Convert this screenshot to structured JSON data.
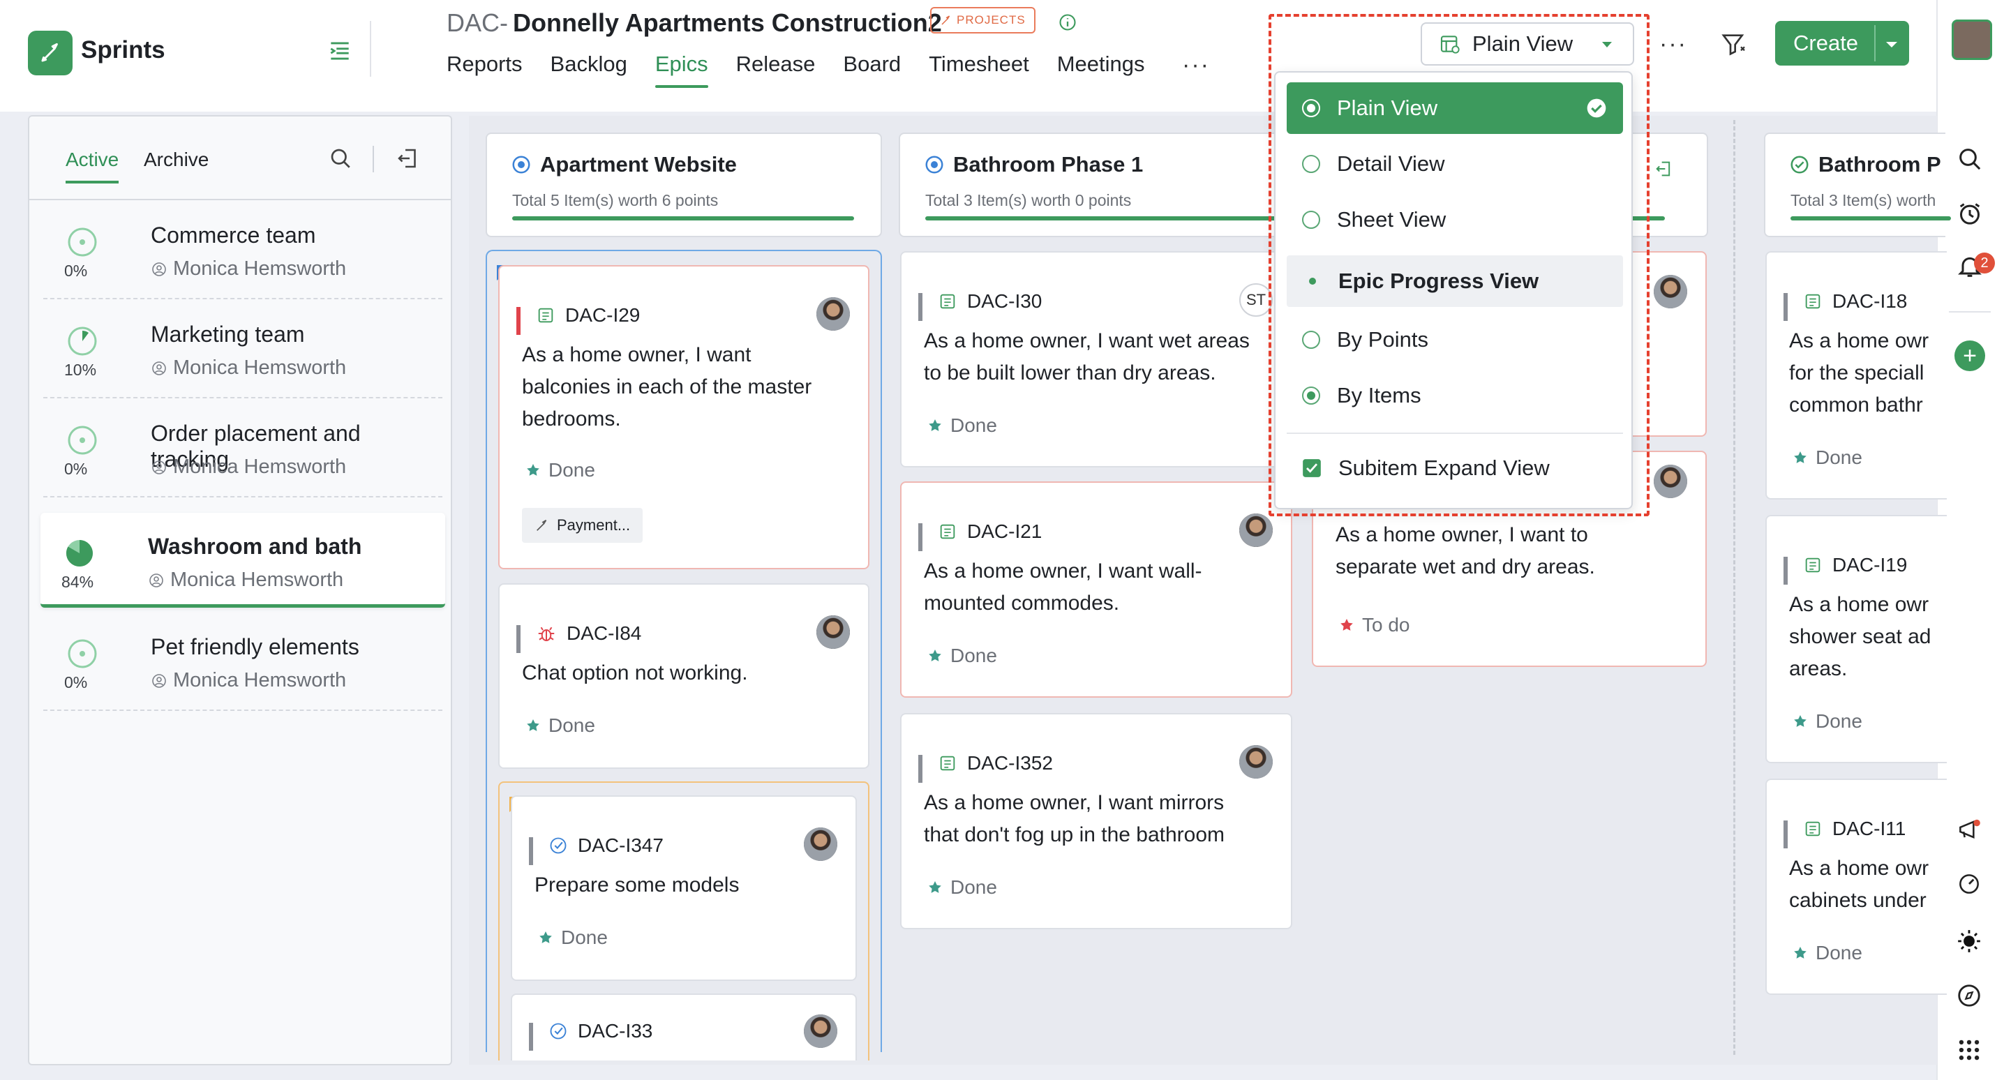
{
  "app": {
    "name": "Sprints"
  },
  "project": {
    "key": "DAC-",
    "name": "Donnelly Apartments Construction2",
    "badge": "PROJECTS"
  },
  "nav": {
    "items": [
      "Reports",
      "Backlog",
      "Epics",
      "Release",
      "Board",
      "Timesheet",
      "Meetings"
    ],
    "active": "Epics",
    "more": "···"
  },
  "toolbar": {
    "view_label": "Plain View",
    "more": "···",
    "create_label": "Create"
  },
  "view_menu": {
    "items": [
      {
        "label": "Plain View",
        "kind": "radio",
        "selected": true
      },
      {
        "label": "Detail View",
        "kind": "radio",
        "selected": false
      },
      {
        "label": "Sheet View",
        "kind": "radio",
        "selected": false
      },
      {
        "label": "Epic Progress View",
        "kind": "toggle-dot",
        "selected": true
      },
      {
        "label": "By Points",
        "kind": "radio",
        "selected": false
      },
      {
        "label": "By Items",
        "kind": "radio",
        "selected": true
      },
      {
        "label": "Subitem Expand View",
        "kind": "checkbox",
        "selected": true
      }
    ]
  },
  "sidebar": {
    "tabs": [
      "Active",
      "Archive"
    ],
    "active_tab": "Active",
    "sprints": [
      {
        "name": "Commerce team",
        "percent": "0%",
        "owner": "Monica Hemsworth",
        "progress": 0
      },
      {
        "name": "Marketing team",
        "percent": "10%",
        "owner": "Monica Hemsworth",
        "progress": 0.1
      },
      {
        "name": "Order placement and tracking",
        "percent": "0%",
        "owner": "Monica Hemsworth",
        "progress": 0
      },
      {
        "name": "Washroom and bath",
        "percent": "84%",
        "owner": "Monica Hemsworth",
        "progress": 0.84,
        "selected": true
      },
      {
        "name": "Pet friendly elements",
        "percent": "0%",
        "owner": "Monica Hemsworth",
        "progress": 0
      }
    ]
  },
  "columns": [
    {
      "title": "Apartment Website",
      "summary": "Total 5 Item(s) worth 6 points"
    },
    {
      "title": "Bathroom Phase 1",
      "summary": "Total 3 Item(s) worth 0 points"
    },
    {
      "title": "Bathroom P",
      "summary": "Total 3 Item(s) worth"
    }
  ],
  "cards": {
    "c1": {
      "id": "DAC-I29",
      "desc1": "As a home owner, I want",
      "desc2": "balconies in each of the master",
      "desc3": "bedrooms.",
      "status": "Done",
      "tag": "Payment..."
    },
    "c2": {
      "id": "DAC-I84",
      "desc1": "Chat option not working.",
      "status": "Done"
    },
    "c3": {
      "id": "DAC-I347",
      "desc1": "Prepare some models",
      "status": "Done"
    },
    "c4": {
      "id": "DAC-I33"
    },
    "c5": {
      "id": "DAC-I30",
      "desc1": "As a home owner, I want wet areas",
      "desc2": "to be built lower than dry areas.",
      "status": "Done",
      "initials": "ST"
    },
    "c6": {
      "id": "DAC-I21",
      "desc1": "As a home owner, I want wall-",
      "desc2": "mounted commodes.",
      "status": "Done"
    },
    "c7": {
      "id": "DAC-I352",
      "desc1": "As a home owner, I want mirrors",
      "desc2": "that don't fog up in the bathroom",
      "status": "Done"
    },
    "c8": {
      "desc1": "As a home owner, I want to",
      "desc2": "separate wet and dry areas.",
      "status": "To do"
    },
    "c9": {
      "id": "DAC-I18",
      "desc1": "As a home owr",
      "desc2": "for the speciall",
      "desc3": "common bathr",
      "status": "Done"
    },
    "c10": {
      "id": "DAC-I19",
      "desc1": "As a home owr",
      "desc2": "shower seat ad",
      "desc3": "areas.",
      "status": "Done"
    },
    "c11": {
      "id": "DAC-I11",
      "desc1": "As a home owr",
      "desc2": "cabinets under",
      "status": "Done"
    }
  },
  "rail": {
    "notification_count": "2"
  },
  "colors": {
    "accent": "#3d9a5d",
    "highlight_border": "#e5402f",
    "todo_star": "#e0434b"
  }
}
